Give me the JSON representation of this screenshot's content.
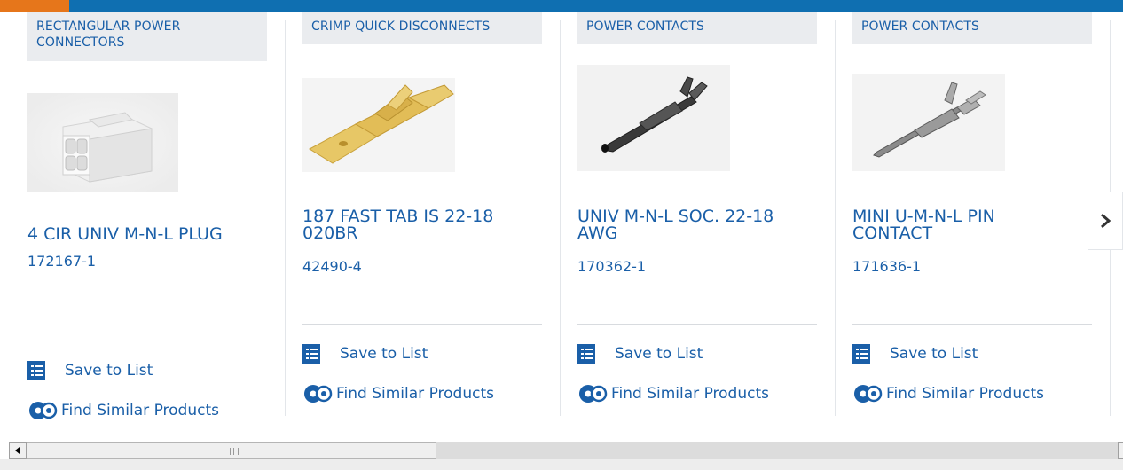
{
  "colors": {
    "brand_blue": "#0f6fb1",
    "brand_orange": "#e6761b",
    "link_blue": "#1a5fa8",
    "category_bg": "#eaecef"
  },
  "products": [
    {
      "category": "RECTANGULAR POWER CONNECTORS",
      "title": "4 CIR UNIV M-N-L PLUG",
      "part_number": "172167-1",
      "image_icon": "white-4-position-connector-housing",
      "save_label": "Save to List",
      "similar_label": "Find Similar Products"
    },
    {
      "category": "CRIMP QUICK DISCONNECTS",
      "title": "187 FAST TAB IS 22-18 020BR",
      "part_number": "42490-4",
      "image_icon": "brass-quick-disconnect-tab",
      "save_label": "Save to List",
      "similar_label": "Find Similar Products"
    },
    {
      "category": "POWER CONTACTS",
      "title": "UNIV M-N-L SOC. 22-18 AWG",
      "part_number": "170362-1",
      "image_icon": "socket-contact",
      "save_label": "Save to List",
      "similar_label": "Find Similar Products"
    },
    {
      "category": "POWER CONTACTS",
      "title": "MINI U-M-N-L PIN CONTACT",
      "part_number": "171636-1",
      "image_icon": "pin-contact",
      "save_label": "Save to List",
      "similar_label": "Find Similar Products"
    }
  ],
  "icons": {
    "save": "checklist-icon",
    "similar": "gears-icon",
    "next": "chevron-right-icon"
  }
}
